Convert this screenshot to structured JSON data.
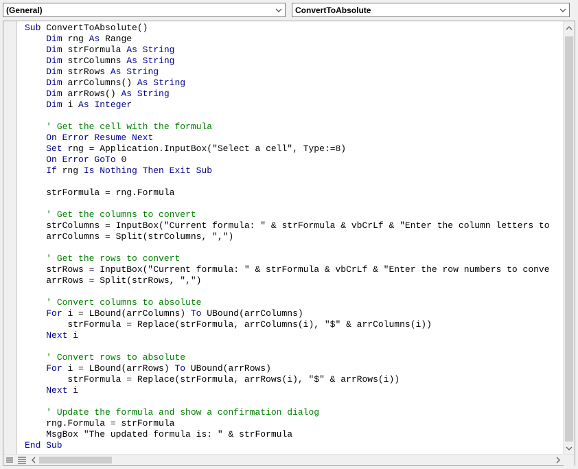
{
  "toolbar": {
    "object_combo": "(General)",
    "procedure_combo": "ConvertToAbsolute"
  },
  "colors": {
    "keyword": "#00008b",
    "comment": "#008000",
    "text": "#000000"
  },
  "code": [
    [
      [
        "kw",
        "Sub "
      ],
      [
        "t",
        "ConvertToAbsolute()"
      ]
    ],
    [
      [
        "t",
        "    "
      ],
      [
        "kw",
        "Dim "
      ],
      [
        "t",
        "rng "
      ],
      [
        "kw",
        "As "
      ],
      [
        "t",
        "Range"
      ]
    ],
    [
      [
        "t",
        "    "
      ],
      [
        "kw",
        "Dim "
      ],
      [
        "t",
        "strFormula "
      ],
      [
        "kw",
        "As String"
      ]
    ],
    [
      [
        "t",
        "    "
      ],
      [
        "kw",
        "Dim "
      ],
      [
        "t",
        "strColumns "
      ],
      [
        "kw",
        "As String"
      ]
    ],
    [
      [
        "t",
        "    "
      ],
      [
        "kw",
        "Dim "
      ],
      [
        "t",
        "strRows "
      ],
      [
        "kw",
        "As String"
      ]
    ],
    [
      [
        "t",
        "    "
      ],
      [
        "kw",
        "Dim "
      ],
      [
        "t",
        "arrColumns() "
      ],
      [
        "kw",
        "As String"
      ]
    ],
    [
      [
        "t",
        "    "
      ],
      [
        "kw",
        "Dim "
      ],
      [
        "t",
        "arrRows() "
      ],
      [
        "kw",
        "As String"
      ]
    ],
    [
      [
        "t",
        "    "
      ],
      [
        "kw",
        "Dim "
      ],
      [
        "t",
        "i "
      ],
      [
        "kw",
        "As Integer"
      ]
    ],
    [],
    [
      [
        "t",
        "    "
      ],
      [
        "cm",
        "' Get the cell with the formula"
      ]
    ],
    [
      [
        "t",
        "    "
      ],
      [
        "kw",
        "On Error Resume Next"
      ]
    ],
    [
      [
        "t",
        "    "
      ],
      [
        "kw",
        "Set "
      ],
      [
        "t",
        "rng = Application.InputBox(\"Select a cell\", Type:=8)"
      ]
    ],
    [
      [
        "t",
        "    "
      ],
      [
        "kw",
        "On Error GoTo "
      ],
      [
        "t",
        "0"
      ]
    ],
    [
      [
        "t",
        "    "
      ],
      [
        "kw",
        "If "
      ],
      [
        "t",
        "rng "
      ],
      [
        "kw",
        "Is Nothing Then Exit Sub"
      ]
    ],
    [],
    [
      [
        "t",
        "    strFormula = rng.Formula"
      ]
    ],
    [],
    [
      [
        "t",
        "    "
      ],
      [
        "cm",
        "' Get the columns to convert"
      ]
    ],
    [
      [
        "t",
        "    strColumns = InputBox(\"Current formula: \" & strFormula & vbCrLf & \"Enter the column letters to"
      ]
    ],
    [
      [
        "t",
        "    arrColumns = Split(strColumns, \",\")"
      ]
    ],
    [],
    [
      [
        "t",
        "    "
      ],
      [
        "cm",
        "' Get the rows to convert"
      ]
    ],
    [
      [
        "t",
        "    strRows = InputBox(\"Current formula: \" & strFormula & vbCrLf & \"Enter the row numbers to conve"
      ]
    ],
    [
      [
        "t",
        "    arrRows = Split(strRows, \",\")"
      ]
    ],
    [],
    [
      [
        "t",
        "    "
      ],
      [
        "cm",
        "' Convert columns to absolute"
      ]
    ],
    [
      [
        "t",
        "    "
      ],
      [
        "kw",
        "For "
      ],
      [
        "t",
        "i = LBound(arrColumns) "
      ],
      [
        "kw",
        "To "
      ],
      [
        "t",
        "UBound(arrColumns)"
      ]
    ],
    [
      [
        "t",
        "        strFormula = Replace(strFormula, arrColumns(i), \"$\" & arrColumns(i))"
      ]
    ],
    [
      [
        "t",
        "    "
      ],
      [
        "kw",
        "Next "
      ],
      [
        "t",
        "i"
      ]
    ],
    [],
    [
      [
        "t",
        "    "
      ],
      [
        "cm",
        "' Convert rows to absolute"
      ]
    ],
    [
      [
        "t",
        "    "
      ],
      [
        "kw",
        "For "
      ],
      [
        "t",
        "i = LBound(arrRows) "
      ],
      [
        "kw",
        "To "
      ],
      [
        "t",
        "UBound(arrRows)"
      ]
    ],
    [
      [
        "t",
        "        strFormula = Replace(strFormula, arrRows(i), \"$\" & arrRows(i))"
      ]
    ],
    [
      [
        "t",
        "    "
      ],
      [
        "kw",
        "Next "
      ],
      [
        "t",
        "i"
      ]
    ],
    [],
    [
      [
        "t",
        "    "
      ],
      [
        "cm",
        "' Update the formula and show a confirmation dialog"
      ]
    ],
    [
      [
        "t",
        "    rng.Formula = strFormula"
      ]
    ],
    [
      [
        "t",
        "    MsgBox \"The updated formula is: \" & strFormula"
      ]
    ],
    [
      [
        "kw",
        "End Sub"
      ]
    ]
  ]
}
